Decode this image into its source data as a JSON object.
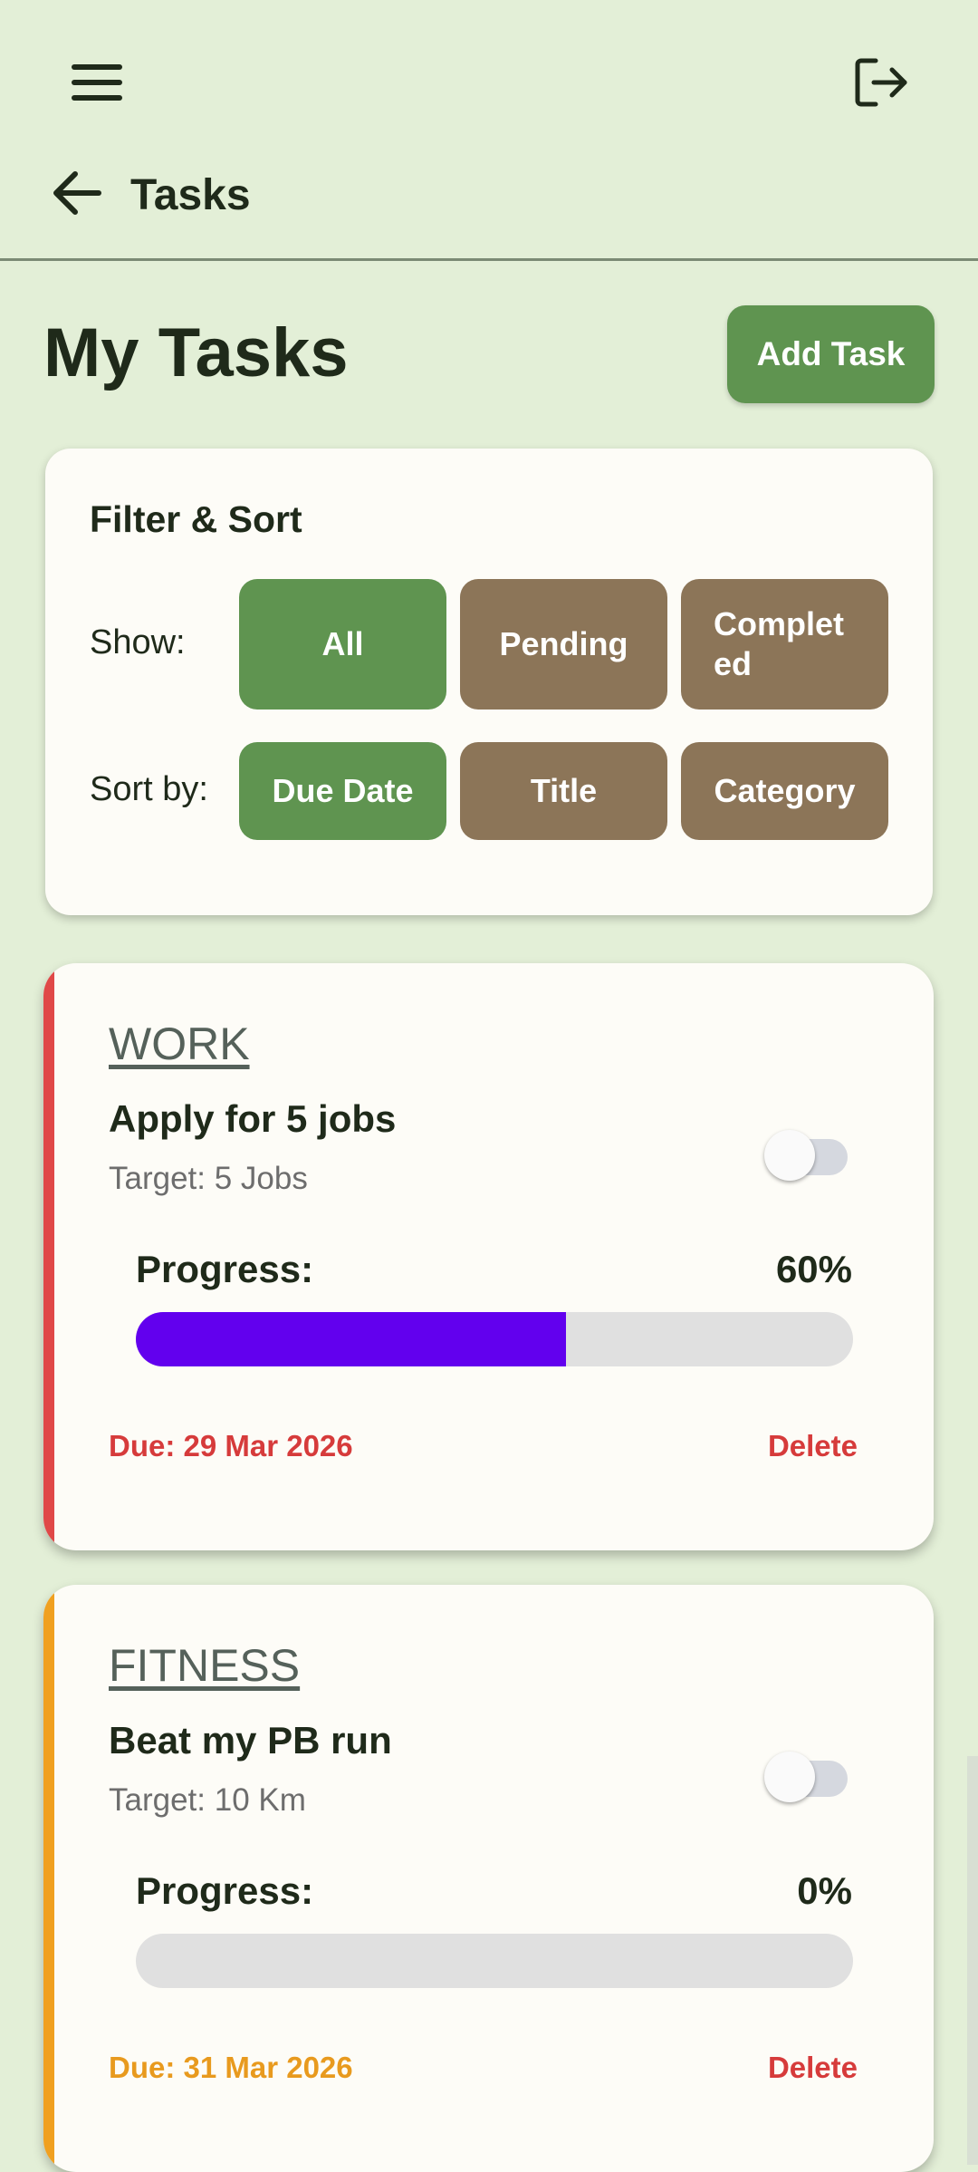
{
  "app_bar": {
    "menu_icon": "menu-icon",
    "logout_icon": "logout-icon"
  },
  "nav": {
    "back_icon": "arrow-left-icon",
    "title": "Tasks"
  },
  "page": {
    "title": "My Tasks",
    "add_task_label": "Add Task"
  },
  "filter": {
    "heading": "Filter & Sort",
    "show_label": "Show:",
    "show_options": [
      "All",
      "Pending",
      "Complet\ned"
    ],
    "show_selected": "All",
    "sort_label": "Sort by:",
    "sort_options": [
      "Due Date",
      "Title",
      "Category"
    ],
    "sort_selected": "Due Date"
  },
  "tasks": [
    {
      "category": "WORK",
      "title": "Apply for 5 jobs",
      "target": "Target: 5 Jobs",
      "progress_label": "Progress:",
      "progress_text": "60%",
      "progress_fraction": 0.6,
      "due": "Due: 29 Mar 2026",
      "delete_label": "Delete",
      "accent_color": "#e04848",
      "due_color": "#d63b3b",
      "completed": false
    },
    {
      "category": "FITNESS",
      "title": "Beat my PB run",
      "target": "Target: 10 Km",
      "progress_label": "Progress:",
      "progress_text": "0%",
      "progress_fraction": 0,
      "due": "Due: 31 Mar 2026",
      "delete_label": "Delete",
      "accent_color": "#f0a020",
      "due_color": "#e89a1e",
      "completed": false
    }
  ],
  "colors": {
    "background": "#e3efd7",
    "primary": "#5f9450",
    "chip_inactive": "#8c7558",
    "progress_fill": "#6200ee"
  }
}
